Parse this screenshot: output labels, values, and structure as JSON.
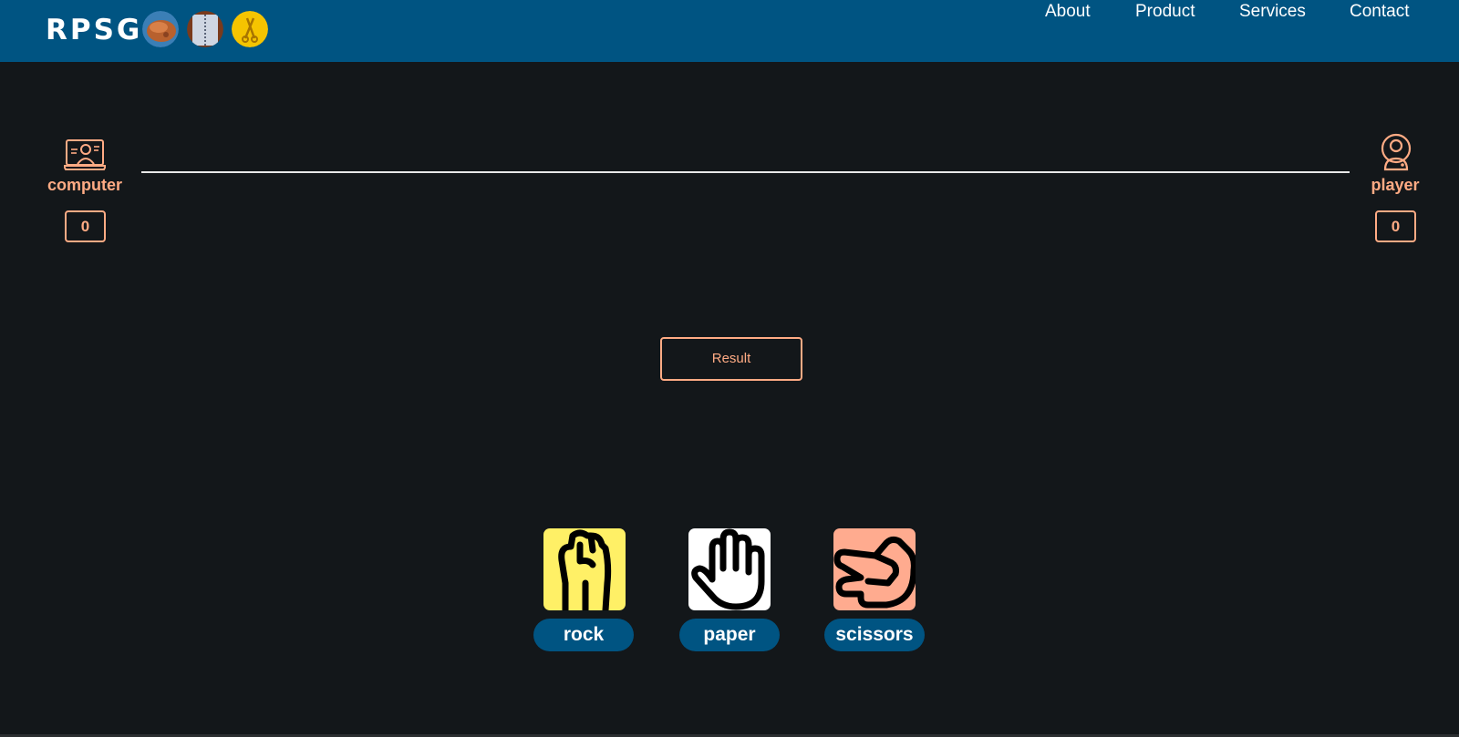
{
  "header": {
    "brand": "RPSG",
    "nav": [
      "About",
      "Product",
      "Services",
      "Contact"
    ]
  },
  "scoreboard": {
    "computer_label": "computer",
    "computer_score": "0",
    "player_label": "player",
    "player_score": "0"
  },
  "result_button": "Result",
  "choices": [
    "rock",
    "paper",
    "scissors"
  ],
  "colors": {
    "nav_bg": "#005482",
    "page_bg": "#13171a",
    "accent": "#ffab84",
    "rock_tile": "#fff066",
    "paper_tile": "#ffffff",
    "scissors_tile": "#ffab8f"
  },
  "icons": {
    "computer": "laptop-user-icon",
    "player": "user-circle-icon",
    "rock": "fist-icon",
    "paper": "open-hand-icon",
    "scissors": "scissors-hand-icon"
  }
}
